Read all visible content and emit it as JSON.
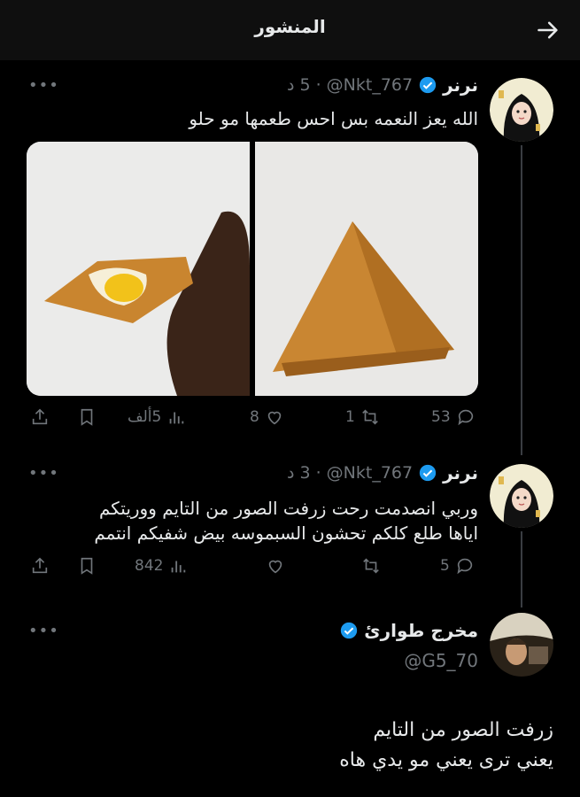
{
  "header": {
    "title": "المنشور",
    "back_icon": "arrow-right-icon"
  },
  "posts": [
    {
      "name": "نرنر",
      "handle": "@Nkt_767",
      "time": "· 5 د",
      "text": "الله يعز النعمه بس احس طعمها مو حلو",
      "actions": {
        "replies": "53",
        "reposts": "1",
        "likes": "8",
        "views": "5ألف"
      }
    },
    {
      "name": "نرنر",
      "handle": "@Nkt_767",
      "time": "· 3 د",
      "text_lines": [
        "وربي انصدمت رحت زرفت الصور من التايم ووريتكم",
        "اياها طلع كلكم تحشون السبموسه بيض شفيكم انتمم"
      ],
      "actions": {
        "replies": "5",
        "reposts": "",
        "likes": "",
        "views": "842"
      }
    },
    {
      "name": "مخرج طوارئ",
      "handle": "@G5_70",
      "text_lines": [
        "زرفت الصور من التايم",
        "يعني ترى يعني مو يدي هاه"
      ]
    }
  ],
  "more_label": "•••",
  "colors": {
    "background": "#000000",
    "text": "#e7e9ea",
    "muted": "#71767b",
    "verified": "#1d9bf0"
  }
}
